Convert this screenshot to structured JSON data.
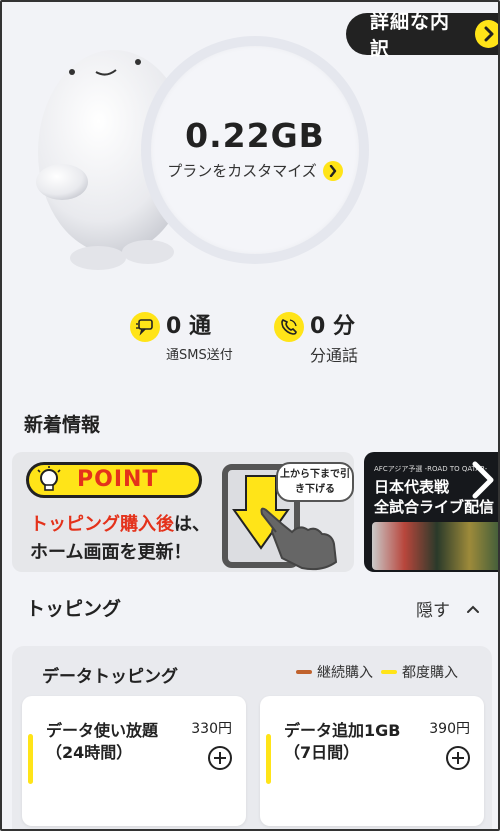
{
  "header": {
    "detail_label": "詳細な内訳"
  },
  "usage": {
    "data_amount": "0.22GB",
    "customize_label": "プランをカスタマイズ"
  },
  "stats": {
    "sms_value": "0 通",
    "sms_label": "通SMS送付",
    "call_value": "0 分",
    "call_label": "分通話"
  },
  "news": {
    "title": "新着情報",
    "banner1": {
      "badge": "POINT",
      "line1_red": "トッピング購入後",
      "line1_rest": "は、",
      "line2": "ホーム画面を更新！",
      "bubble": "上から下まで引き下げる"
    },
    "banner2": {
      "tag": "AFCアジア予選 -ROAD TO QATAR-",
      "line1": "日本代表戦",
      "line2": "全試合ライブ配信"
    }
  },
  "toppings": {
    "title": "トッピング",
    "hide_label": "隠す",
    "data_title": "データトッピング",
    "legend": [
      {
        "label": "継続購入",
        "color": "#c0622d"
      },
      {
        "label": "都度購入",
        "color": "#ffe418"
      }
    ],
    "options": [
      {
        "name": "データ使い放題（24時間）",
        "price": "330円"
      },
      {
        "name": "データ追加1GB（7日間）",
        "price": "390円"
      }
    ]
  },
  "colors": {
    "accent": "#ffe418",
    "dark": "#222222",
    "red": "#e4321b"
  }
}
